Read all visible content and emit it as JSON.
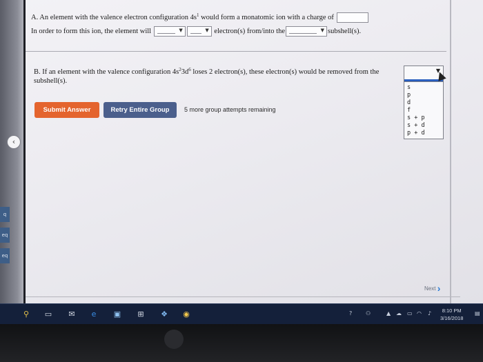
{
  "partA": {
    "prefix": "A. An element with the valence electron configuration 4s",
    "sup": "1",
    "middle": " would form a monatomic ion with a charge of",
    "line2_start": "In order to form this ion, the element will",
    "line2_mid": "electron(s) from/into the",
    "line2_end": "subshell(s)."
  },
  "partB": {
    "prefix": "B. If an element with the valence configuration 4s",
    "sup1": "2",
    "mid": "3d",
    "sup2": "6",
    "suffix": " loses 2 electron(s), these electron(s) would be removed from the",
    "line2": "subshell(s).",
    "options": [
      "s",
      "p",
      "d",
      "f",
      "s + p",
      "s + d",
      "p + d"
    ]
  },
  "buttons": {
    "submit": "Submit Answer",
    "retry": "Retry Entire Group"
  },
  "attempts_text": "5 more group attempts remaining",
  "next_label": "Next",
  "sidebar_tabs": [
    "q",
    "eq",
    "eq"
  ],
  "taskbar": {
    "clock_time": "8:10 PM",
    "clock_date": "3/16/2018"
  },
  "colors": {
    "submit": "#e4642e",
    "retry": "#4b5f8c",
    "taskbar": "#14203a",
    "dropdown_highlight": "#2a5fbf"
  }
}
